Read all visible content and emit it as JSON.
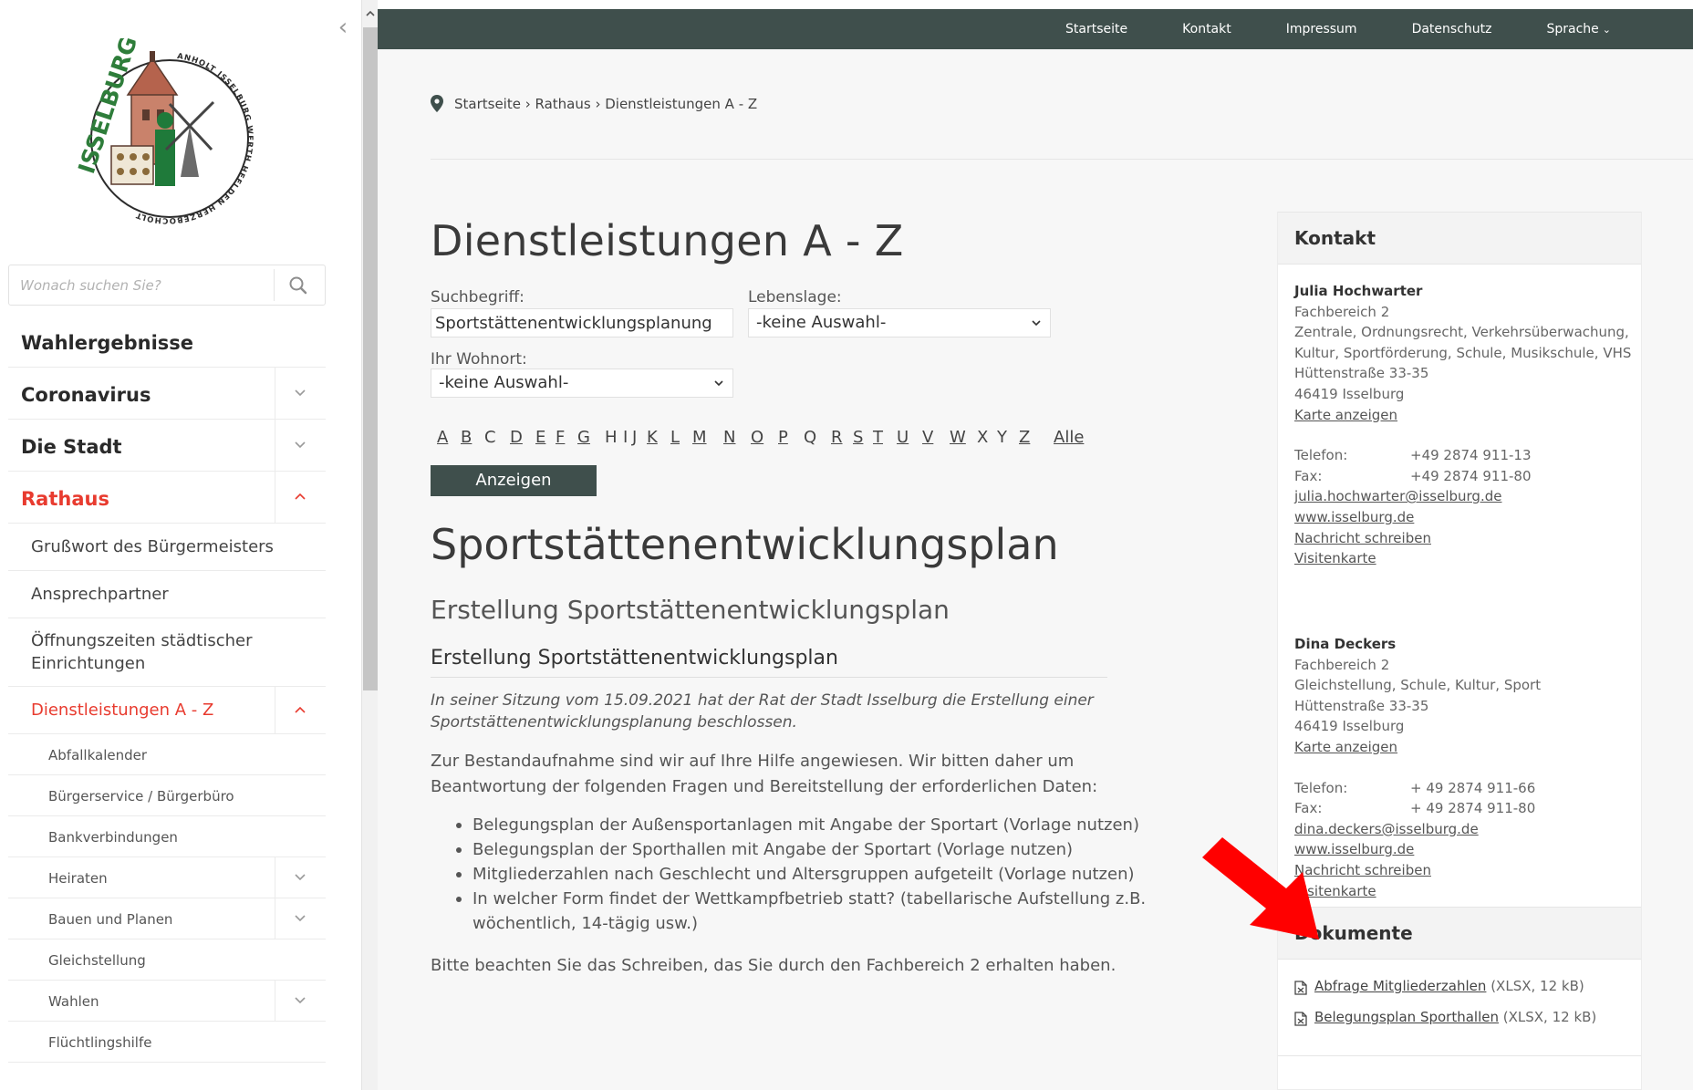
{
  "sidebar": {
    "search_placeholder": "Wonach suchen Sie?",
    "logo_text": "ISSELBURG",
    "logo_ring_text": "ANHOLT ISSELBURG WERTH HEELDEN HERZEBOCHOLT VEHLINGEN",
    "nav": [
      {
        "label": "Wahlergebnisse",
        "level": 1,
        "chevron": "none"
      },
      {
        "label": "Coronavirus",
        "level": 1,
        "chevron": "down"
      },
      {
        "label": "Die Stadt",
        "level": 1,
        "chevron": "down"
      },
      {
        "label": "Rathaus",
        "level": 1,
        "chevron": "up",
        "active": true
      },
      {
        "label": "Grußwort des Bürgermeisters",
        "level": 2,
        "chevron": "none"
      },
      {
        "label": "Ansprechpartner",
        "level": 2,
        "chevron": "none"
      },
      {
        "label": "Öffnungszeiten städtischer Einrichtungen",
        "level": 2,
        "chevron": "none"
      },
      {
        "label": "Dienstleistungen A - Z",
        "level": 2,
        "chevron": "up",
        "active": true
      },
      {
        "label": "Abfallkalender",
        "level": 3,
        "chevron": "none"
      },
      {
        "label": "Bürgerservice / Bürgerbüro",
        "level": 3,
        "chevron": "none"
      },
      {
        "label": "Bankverbindungen",
        "level": 3,
        "chevron": "none"
      },
      {
        "label": "Heiraten",
        "level": 3,
        "chevron": "down"
      },
      {
        "label": "Bauen und Planen",
        "level": 3,
        "chevron": "down"
      },
      {
        "label": "Gleichstellung",
        "level": 3,
        "chevron": "none"
      },
      {
        "label": "Wahlen",
        "level": 3,
        "chevron": "down"
      },
      {
        "label": "Flüchtlingshilfe",
        "level": 3,
        "chevron": "none"
      }
    ]
  },
  "topnav": {
    "items": [
      "Startseite",
      "Kontakt",
      "Impressum",
      "Datenschutz"
    ],
    "language": "Sprache"
  },
  "breadcrumb": "Startseite › Rathaus › Dienstleistungen A - Z",
  "page_title": "Dienstleistungen A - Z",
  "filters": {
    "search_label": "Suchbegriff:",
    "search_value": "Sportstättenentwicklungsplanung",
    "situation_label": "Lebenslage:",
    "situation_value": "-keine Auswahl-",
    "residence_label": "Ihr Wohnort:",
    "residence_value": "-keine Auswahl-",
    "letters": [
      "A",
      "B",
      "C",
      "D",
      "E",
      "F",
      "G",
      "H",
      "I",
      "J",
      "K",
      "L",
      "M",
      "N",
      "O",
      "P",
      "Q",
      "R",
      "S",
      "T",
      "U",
      "V",
      "W",
      "X",
      "Y",
      "Z",
      "Alle"
    ],
    "button_label": "Anzeigen"
  },
  "service": {
    "title": "Sportstättenentwicklungsplan",
    "subtitle": "Erstellung Sportstättenentwicklungsplan",
    "heading": "Erstellung Sportstättenentwicklungsplan",
    "intro": "In seiner Sitzung vom 15.09.2021 hat der Rat der Stadt Isselburg die Erstellung einer Sportstättenentwicklungsplanung beschlossen.",
    "text": "Zur Bestandaufnahme sind wir auf Ihre Hilfe angewiesen. Wir bitten daher um Beantwortung der folgenden Fragen und Bereitstellung der erforderlichen Daten:",
    "bullets": [
      "Belegungsplan der Außensportanlagen mit Angabe der Sportart (Vorlage nutzen)",
      "Belegungsplan der Sporthallen mit Angabe der Sportart (Vorlage nutzen)",
      "Mitgliederzahlen nach Geschlecht und Altersgruppen aufgeteilt (Vorlage nutzen)",
      "In welcher Form findet der Wettkampfbetrieb statt? (tabellarische Aufstellung z.B. wöchentlich, 14-tägig usw.)"
    ],
    "note": "Bitte beachten Sie das Schreiben, das Sie durch den Fachbereich 2 erhalten haben."
  },
  "contact_box": {
    "title": "Kontakt",
    "contacts": [
      {
        "name": "Julia Hochwarter",
        "dept": "Fachbereich 2",
        "areas": "Zentrale, Ordnungsrecht, Verkehrsüberwachung, Kultur, Sportförderung, Schule, Musikschule, VHS",
        "street": "Hüttenstraße 33-35",
        "city": "46419 Isselburg",
        "map_link": "Karte anzeigen",
        "phone_label": "Telefon:",
        "phone": "+49 2874 911-13",
        "fax_label": "Fax:",
        "fax": "+49 2874 911-80",
        "email": "julia.hochwarter@isselburg.de",
        "web": "www.isselburg.de",
        "message": "Nachricht schreiben",
        "vcard": "Visitenkarte"
      },
      {
        "name": "Dina Deckers",
        "dept": "Fachbereich 2",
        "areas": "Gleichstellung, Schule, Kultur, Sport",
        "street": "Hüttenstraße 33-35",
        "city": "46419 Isselburg",
        "map_link": "Karte anzeigen",
        "phone_label": "Telefon:",
        "phone": "+ 49 2874 911-66",
        "fax_label": "Fax:",
        "fax": "+ 49 2874 911-80",
        "email": "dina.deckers@isselburg.de",
        "web": "www.isselburg.de",
        "message": "Nachricht schreiben",
        "vcard": "Visitenkarte"
      }
    ]
  },
  "documents_box": {
    "title": "Dokumente",
    "items": [
      {
        "label": "Abfrage Mitgliederzahlen",
        "meta": "(XLSX, 12 kB)"
      },
      {
        "label": "Belegungsplan Sporthallen",
        "meta": "(XLSX, 12 kB)"
      }
    ]
  },
  "colors": {
    "accent_red": "#e83b2f",
    "topbar": "#3f4f4c",
    "button": "#3f4f4c",
    "annotation_arrow": "#ff0000"
  }
}
